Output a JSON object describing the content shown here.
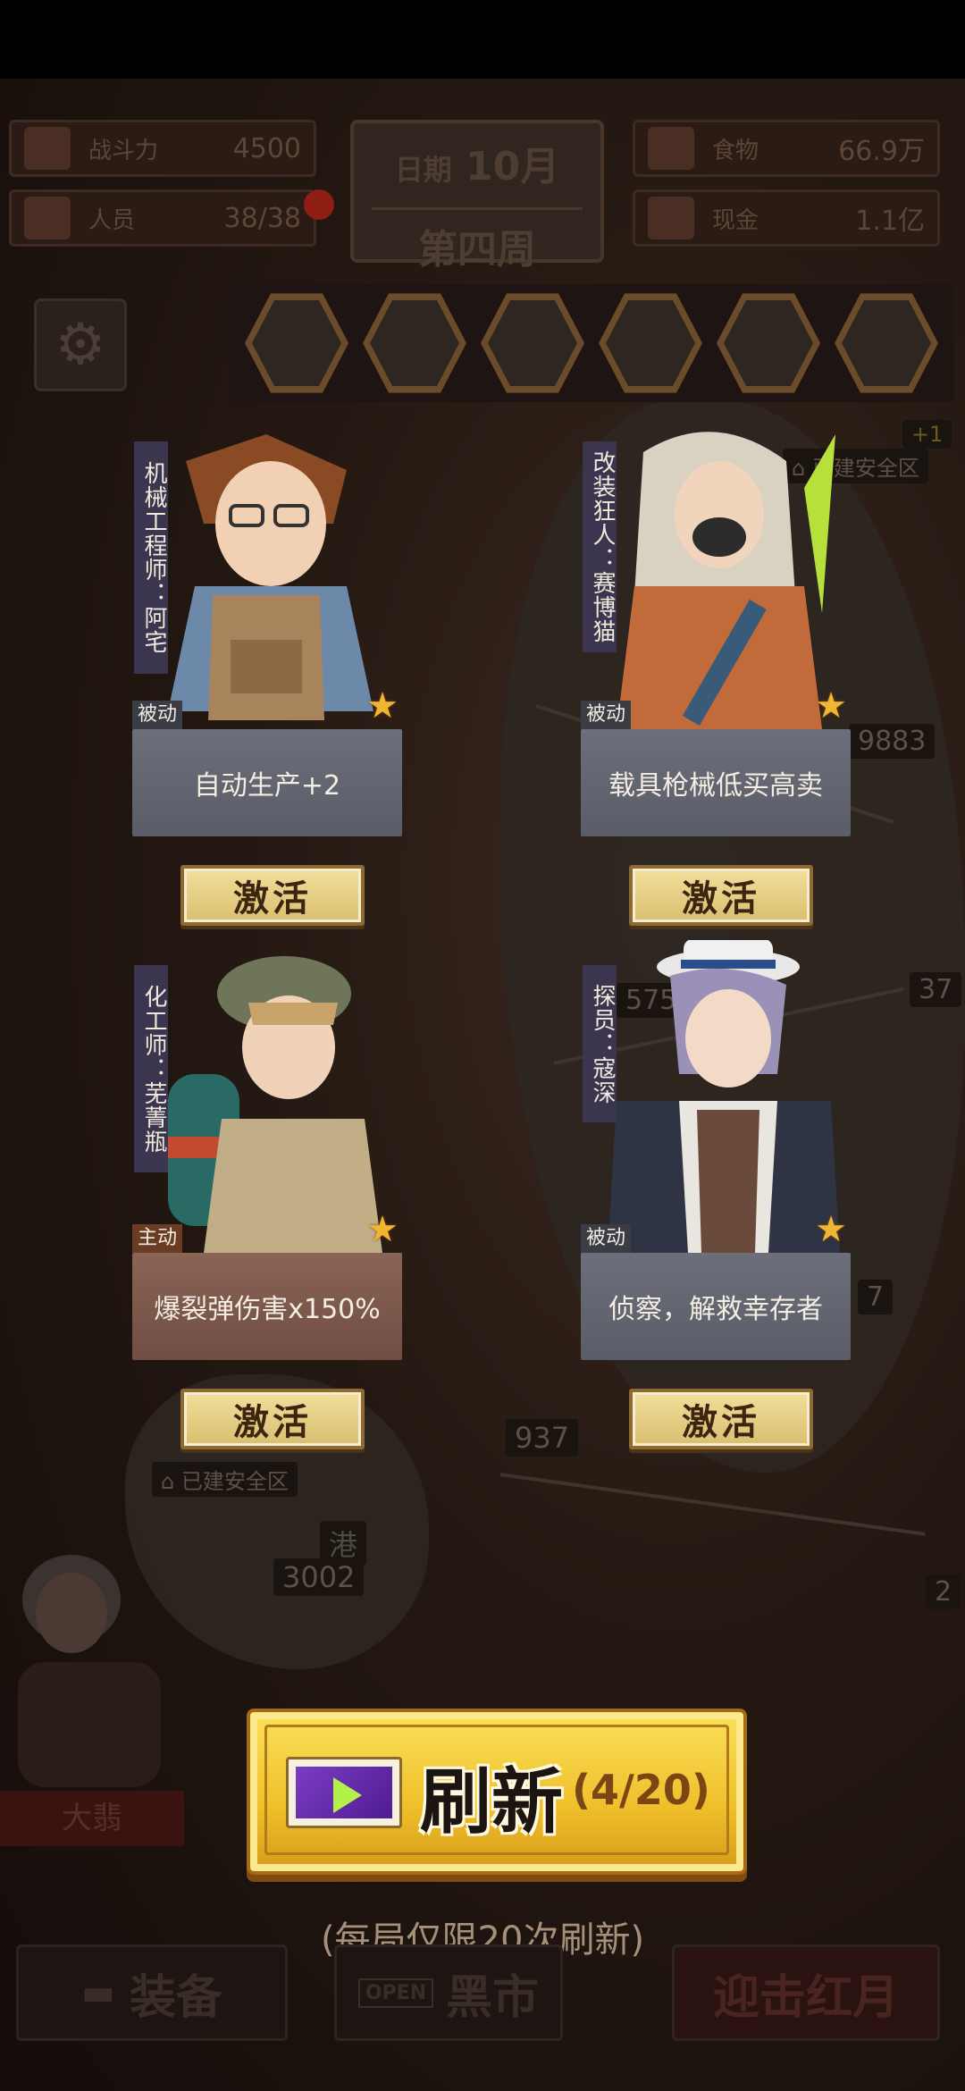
{
  "hud": {
    "power_label": "战斗力",
    "power_value": "4500",
    "staff_label": "人员",
    "staff_value": "38/38",
    "date_label": "日期",
    "month": "10月",
    "week": "第四周",
    "food_label": "食物",
    "food_value": "66.9万",
    "cash_label": "现金",
    "cash_value": "1.1亿"
  },
  "map_badges": {
    "safe_zone_1": "已建安全区",
    "safe_zone_2": "已建安全区",
    "plus_one": "+1",
    "v9883": "9883",
    "v575": "575",
    "v37": "37",
    "v7": "7",
    "v937": "937",
    "v3002": "3002",
    "port": "港",
    "v2": "2"
  },
  "cards": [
    {
      "name": "机械工程师：阿宅",
      "tag": "被动",
      "skill": "自动生产+2",
      "button": "激活",
      "type": "passive"
    },
    {
      "name": "改装狂人：赛博猫",
      "tag": "被动",
      "skill": "载具枪械低买高卖",
      "button": "激活",
      "type": "passive"
    },
    {
      "name": "化工师：芜菁瓶",
      "tag": "主动",
      "skill": "爆裂弹伤害x150%",
      "button": "激活",
      "type": "active"
    },
    {
      "name": "探员：寇深",
      "tag": "被动",
      "skill": "侦察，解救幸存者",
      "button": "激活",
      "type": "passive"
    }
  ],
  "refresh": {
    "label": "刷新",
    "count": "(4/20)",
    "note": "(每局仅限20次刷新)"
  },
  "side_character": {
    "name": "大翡"
  },
  "bottom_nav": {
    "equip": "装备",
    "market": "黑市",
    "market_sign": "OPEN",
    "redmoon": "迎击红月"
  },
  "colors": {
    "passive_skill_bg": "#5e616c",
    "active_skill_bg": "#765347",
    "activate_btn": "#e8d088",
    "refresh_btn": "#f2c630",
    "star": "#f2b531",
    "name_strip": "#3c3550"
  }
}
